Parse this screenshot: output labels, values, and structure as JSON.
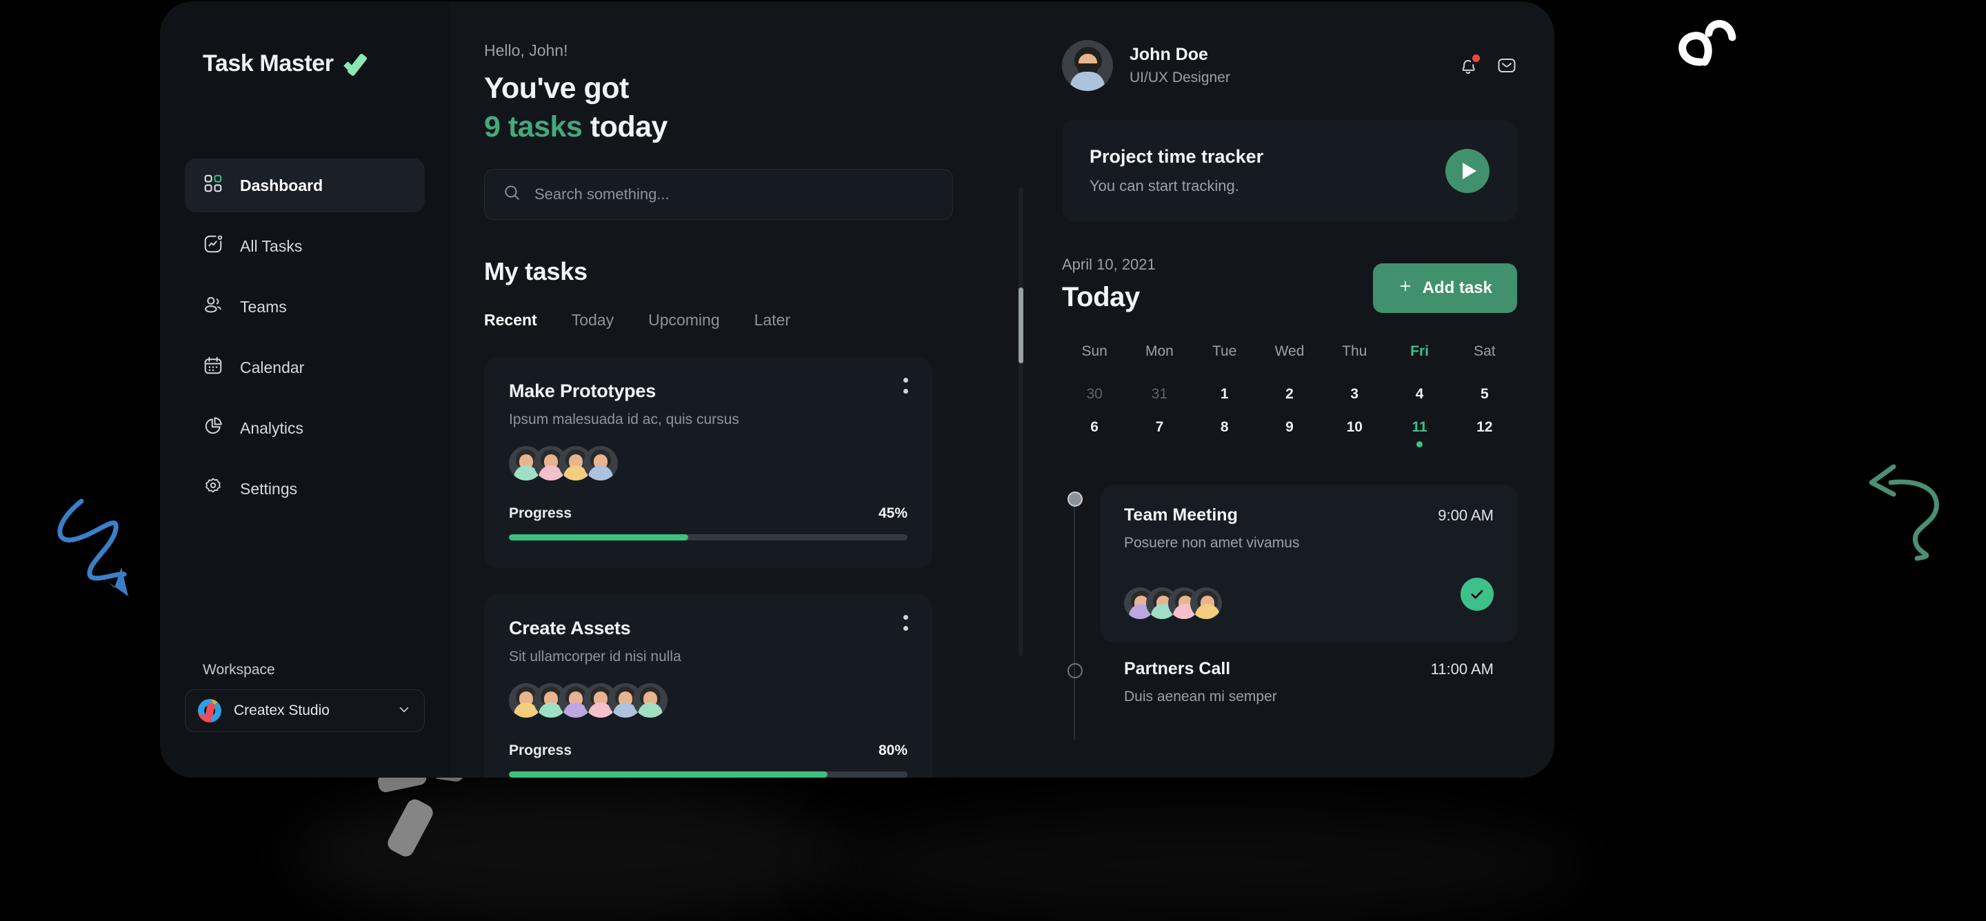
{
  "brand": {
    "name": "Task Master",
    "mark": "check-mark-logo"
  },
  "sidebar": {
    "items": [
      {
        "label": "Dashboard",
        "icon": "grid-icon",
        "active": true
      },
      {
        "label": "All Tasks",
        "icon": "chart-square-icon",
        "active": false
      },
      {
        "label": "Teams",
        "icon": "people-icon",
        "active": false
      },
      {
        "label": "Calendar",
        "icon": "calendar-icon",
        "active": false
      },
      {
        "label": "Analytics",
        "icon": "pie-chart-icon",
        "active": false
      },
      {
        "label": "Settings",
        "icon": "gear-icon",
        "active": false
      }
    ],
    "workspace": {
      "label": "Workspace",
      "selected": "Createx Studio",
      "chevron": "chevron-down-icon"
    }
  },
  "main": {
    "greeting": "Hello, John!",
    "headline_line1": "You've got",
    "headline_accent": "9 tasks",
    "headline_rest": " today",
    "search": {
      "placeholder": "Search something...",
      "value": "",
      "icon": "search-icon"
    },
    "my_tasks_title": "My tasks",
    "tabs": [
      {
        "label": "Recent",
        "active": true
      },
      {
        "label": "Today",
        "active": false
      },
      {
        "label": "Upcoming",
        "active": false
      },
      {
        "label": "Later",
        "active": false
      }
    ],
    "task_cards": [
      {
        "title": "Make Prototypes",
        "subtitle": "Ipsum malesuada id ac, quis cursus",
        "progress_label": "Progress",
        "progress_value": "45%",
        "progress_pct": 45,
        "avatars": [
          "#9fdfc6",
          "#f4c0cc",
          "#f5cd7e",
          "#adc2dc"
        ],
        "menu_icon": "kebab-menu-icon"
      },
      {
        "title": "Create Assets",
        "subtitle": "Sit ullamcorper id nisi nulla",
        "progress_label": "Progress",
        "progress_value": "80%",
        "progress_pct": 80,
        "avatars": [
          "#f5cd7e",
          "#9fdfc6",
          "#bda7e0",
          "#f4c0cc",
          "#adc2dc",
          "#9fdfc6"
        ],
        "menu_icon": "kebab-menu-icon"
      }
    ]
  },
  "right": {
    "profile": {
      "name": "John Doe",
      "role": "UI/UX Designer",
      "avatar": "user-avatar"
    },
    "header_icons": [
      {
        "name": "bell-icon",
        "has_badge": true
      },
      {
        "name": "mail-icon",
        "has_badge": false
      }
    ],
    "tracker": {
      "title": "Project time tracker",
      "subtitle": "You can start tracking.",
      "play_icon": "play-icon"
    },
    "today": {
      "date": "April 10, 2021",
      "title": "Today",
      "add_button": "Add task",
      "add_icon": "plus-icon"
    },
    "calendar": {
      "day_names": [
        "Sun",
        "Mon",
        "Tue",
        "Wed",
        "Thu",
        "Fri",
        "Sat"
      ],
      "highlight_day": "Fri",
      "week1": [
        "30",
        "31",
        "1",
        "2",
        "3",
        "4",
        "5"
      ],
      "week1_muted": [
        true,
        true,
        false,
        false,
        false,
        false,
        false
      ],
      "week2": [
        "6",
        "7",
        "8",
        "9",
        "10",
        "11",
        "12"
      ],
      "today_value": "11"
    },
    "events": [
      {
        "title": "Team Meeting",
        "subtitle": "Posuere non amet vivamus",
        "time": "9:00 AM",
        "node": "filled",
        "avatars": [
          "#bda7e0",
          "#9fdfc6",
          "#f4c0cc",
          "#f5cd7e"
        ],
        "status_icon": "check-icon"
      },
      {
        "title": "Partners Call",
        "subtitle": "Duis aenean mi semper",
        "time": "11:00 AM",
        "node": "hollow",
        "avatars": [],
        "status_icon": ""
      }
    ]
  },
  "decorations": {
    "blue_arrow": "squiggle-arrow-icon",
    "green_arrow": "curved-arrow-icon",
    "white_loops": "loop-doodle-icon"
  },
  "colors": {
    "accent_green": "#40916c",
    "bright_green": "#3ec08a",
    "panel": "#161b21",
    "device_bg": "#12161b",
    "sidebar_bg": "#0f1318",
    "badge_red": "#f1453d",
    "doodle_blue": "#3a7fc8",
    "doodle_green": "#4b8f74"
  }
}
